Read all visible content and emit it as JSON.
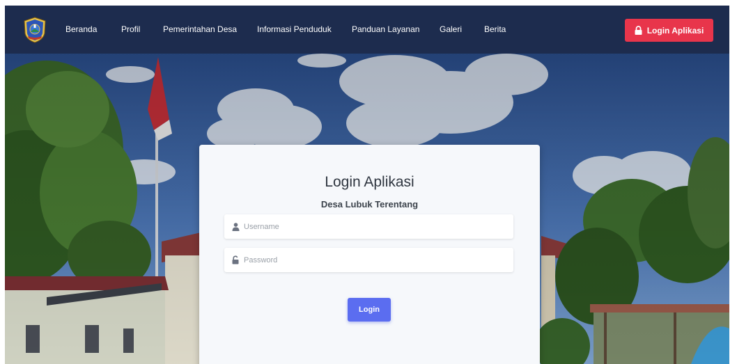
{
  "nav": {
    "items": [
      {
        "label": "Beranda"
      },
      {
        "label": "Profil"
      },
      {
        "label": "Pemerintahan Desa"
      },
      {
        "label": "Informasi Penduduk"
      },
      {
        "label": "Panduan Layanan"
      },
      {
        "label": "Galeri"
      },
      {
        "label": "Berita"
      }
    ],
    "login_button": "Login Aplikasi",
    "logo_icon": "village-emblem-icon",
    "login_icon": "lock-icon"
  },
  "login_card": {
    "title": "Login Aplikasi",
    "subtitle": "Desa Lubuk Terentang",
    "username_placeholder": "Username",
    "password_placeholder": "Password",
    "username_icon": "user-icon",
    "password_icon": "lock-icon",
    "submit_label": "Login"
  },
  "colors": {
    "navbar": "#1d2c4e",
    "login_button": "#e8354b",
    "submit_button": "#5b6df0",
    "card": "#f6f8fb"
  }
}
